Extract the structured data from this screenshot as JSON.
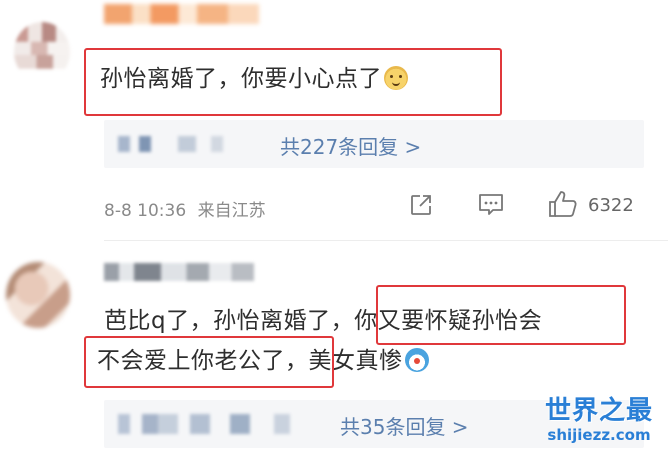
{
  "comments": [
    {
      "text": "孙怡离婚了，你要小心点了",
      "emoji": "doge-emoji",
      "replies_link": "共227条回复 >",
      "date": "8-8 10:36",
      "location": "来自江苏",
      "like_count": "6322"
    },
    {
      "text_line1": "芭比q了，孙怡离婚了，你又要怀疑孙怡会",
      "text_line2": "不会爱上你老公了，美女真惨",
      "emoji": "doraemon-emoji",
      "replies_link": "共35条回复 >"
    }
  ],
  "watermark": {
    "title": "世界之最",
    "url": "shijiezz.com"
  },
  "colors": {
    "highlight": "#e0383b",
    "link": "#5b7fae",
    "watermark": "#2a7fd6"
  },
  "icons": [
    "share-icon",
    "comment-icon",
    "like-icon"
  ]
}
